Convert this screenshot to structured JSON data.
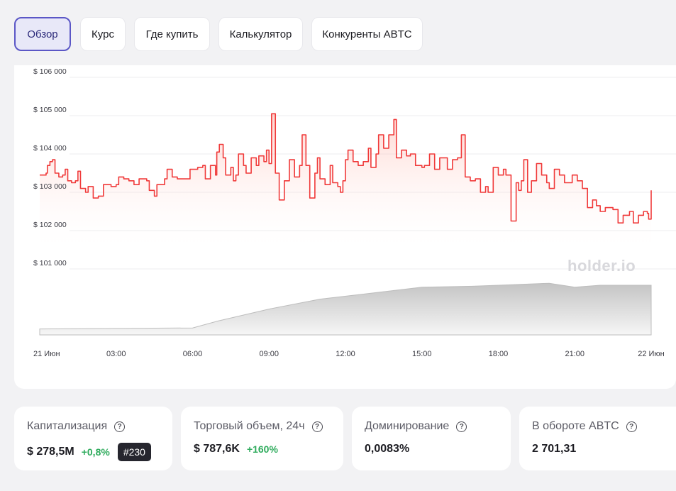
{
  "tabs": [
    {
      "label": "Обзор",
      "active": true
    },
    {
      "label": "Курс",
      "active": false
    },
    {
      "label": "Где купить",
      "active": false
    },
    {
      "label": "Калькулятор",
      "active": false
    },
    {
      "label": "Конкуренты ABTC",
      "active": false
    }
  ],
  "watermark": "holder.io",
  "chart_data": {
    "type": "line",
    "y_tick_labels": [
      "$ 106 000",
      "$ 105 000",
      "$ 104 000",
      "$ 103 000",
      "$ 102 000",
      "$ 101 000"
    ],
    "y_ticks": [
      106000,
      105000,
      104000,
      103000,
      102000,
      101000
    ],
    "ylim": [
      101000,
      106500
    ],
    "x_tick_labels": [
      "21 Июн",
      "03:00",
      "06:00",
      "09:00",
      "12:00",
      "15:00",
      "18:00",
      "21:00",
      "22 Июн"
    ],
    "x_ticks_hours": [
      0,
      3,
      6,
      9,
      12,
      15,
      18,
      21,
      24
    ],
    "xlim_hours": [
      0,
      24
    ],
    "line_color": "#f03a3a",
    "volume_color": "#cfcfcf",
    "grid": true,
    "series": [
      {
        "values": [
          [
            0.0,
            103450
          ],
          [
            0.25,
            103500
          ],
          [
            0.3,
            103700
          ],
          [
            0.4,
            103800
          ],
          [
            0.5,
            103850
          ],
          [
            0.6,
            103500
          ],
          [
            0.75,
            103400
          ],
          [
            0.9,
            103450
          ],
          [
            1.0,
            103600
          ],
          [
            1.1,
            103300
          ],
          [
            1.25,
            103250
          ],
          [
            1.4,
            103300
          ],
          [
            1.5,
            103550
          ],
          [
            1.6,
            103100
          ],
          [
            1.8,
            103000
          ],
          [
            1.9,
            103150
          ],
          [
            2.1,
            102850
          ],
          [
            2.3,
            102900
          ],
          [
            2.5,
            103200
          ],
          [
            2.8,
            103150
          ],
          [
            3.0,
            103200
          ],
          [
            3.1,
            103400
          ],
          [
            3.3,
            103350
          ],
          [
            3.5,
            103300
          ],
          [
            3.7,
            103200
          ],
          [
            3.9,
            103350
          ],
          [
            4.2,
            103300
          ],
          [
            4.3,
            103050
          ],
          [
            4.5,
            102900
          ],
          [
            4.6,
            103200
          ],
          [
            4.9,
            103350
          ],
          [
            5.0,
            103600
          ],
          [
            5.2,
            103400
          ],
          [
            5.4,
            103350
          ],
          [
            5.8,
            103350
          ],
          [
            5.9,
            103600
          ],
          [
            6.2,
            103650
          ],
          [
            6.4,
            103700
          ],
          [
            6.5,
            103350
          ],
          [
            6.7,
            103700
          ],
          [
            6.9,
            103450
          ],
          [
            6.95,
            104050
          ],
          [
            7.05,
            104250
          ],
          [
            7.2,
            103900
          ],
          [
            7.3,
            103450
          ],
          [
            7.5,
            103650
          ],
          [
            7.6,
            103300
          ],
          [
            7.7,
            103450
          ],
          [
            7.8,
            104000
          ],
          [
            8.0,
            103700
          ],
          [
            8.1,
            103500
          ],
          [
            8.3,
            103900
          ],
          [
            8.5,
            103700
          ],
          [
            8.6,
            103950
          ],
          [
            8.8,
            103800
          ],
          [
            8.9,
            104100
          ],
          [
            9.0,
            103750
          ],
          [
            9.1,
            105050
          ],
          [
            9.25,
            103500
          ],
          [
            9.4,
            102800
          ],
          [
            9.6,
            103300
          ],
          [
            9.8,
            103850
          ],
          [
            10.0,
            103400
          ],
          [
            10.2,
            103700
          ],
          [
            10.3,
            104500
          ],
          [
            10.45,
            103700
          ],
          [
            10.6,
            102850
          ],
          [
            10.8,
            103500
          ],
          [
            10.9,
            103900
          ],
          [
            11.0,
            103350
          ],
          [
            11.2,
            103200
          ],
          [
            11.4,
            103700
          ],
          [
            11.5,
            103250
          ],
          [
            11.7,
            103150
          ],
          [
            11.8,
            103000
          ],
          [
            11.9,
            103300
          ],
          [
            12.0,
            103850
          ],
          [
            12.1,
            104100
          ],
          [
            12.3,
            103800
          ],
          [
            12.5,
            103700
          ],
          [
            12.7,
            103800
          ],
          [
            12.9,
            104150
          ],
          [
            13.0,
            103650
          ],
          [
            13.2,
            104000
          ],
          [
            13.3,
            104500
          ],
          [
            13.5,
            104150
          ],
          [
            13.7,
            104500
          ],
          [
            13.9,
            104900
          ],
          [
            14.0,
            103900
          ],
          [
            14.2,
            104100
          ],
          [
            14.4,
            103950
          ],
          [
            14.55,
            104000
          ],
          [
            14.75,
            103700
          ],
          [
            15.0,
            103650
          ],
          [
            15.1,
            103700
          ],
          [
            15.3,
            104000
          ],
          [
            15.5,
            103600
          ],
          [
            15.7,
            103900
          ],
          [
            16.0,
            103600
          ],
          [
            16.2,
            103850
          ],
          [
            16.4,
            103900
          ],
          [
            16.55,
            104500
          ],
          [
            16.7,
            103400
          ],
          [
            16.9,
            103300
          ],
          [
            17.1,
            103350
          ],
          [
            17.3,
            103000
          ],
          [
            17.5,
            103150
          ],
          [
            17.6,
            103000
          ],
          [
            17.8,
            103650
          ],
          [
            18.0,
            103450
          ],
          [
            18.2,
            103600
          ],
          [
            18.3,
            103450
          ],
          [
            18.5,
            102250
          ],
          [
            18.7,
            103250
          ],
          [
            18.8,
            103050
          ],
          [
            18.9,
            103300
          ],
          [
            19.0,
            103850
          ],
          [
            19.15,
            103000
          ],
          [
            19.3,
            103300
          ],
          [
            19.5,
            103750
          ],
          [
            19.7,
            103450
          ],
          [
            19.9,
            103250
          ],
          [
            20.0,
            103100
          ],
          [
            20.2,
            103600
          ],
          [
            20.4,
            103450
          ],
          [
            20.6,
            103250
          ],
          [
            20.9,
            103450
          ],
          [
            21.1,
            103300
          ],
          [
            21.3,
            103100
          ],
          [
            21.5,
            102600
          ],
          [
            21.7,
            102800
          ],
          [
            21.85,
            102650
          ],
          [
            22.0,
            102500
          ],
          [
            22.2,
            102600
          ],
          [
            22.5,
            102550
          ],
          [
            22.7,
            102200
          ],
          [
            22.9,
            102400
          ],
          [
            23.15,
            102500
          ],
          [
            23.3,
            102200
          ],
          [
            23.5,
            102400
          ],
          [
            23.7,
            102500
          ],
          [
            23.85,
            102450
          ],
          [
            23.9,
            102300
          ],
          [
            24.0,
            103050
          ]
        ]
      }
    ],
    "volume_profile_hours_relative": [
      [
        0,
        0.06
      ],
      [
        6,
        0.07
      ],
      [
        7,
        0.14
      ],
      [
        9,
        0.26
      ],
      [
        11,
        0.36
      ],
      [
        13,
        0.42
      ],
      [
        15,
        0.48
      ],
      [
        17,
        0.49
      ],
      [
        18,
        0.5
      ],
      [
        20,
        0.52
      ],
      [
        21,
        0.48
      ],
      [
        22,
        0.5
      ],
      [
        23,
        0.5
      ],
      [
        24,
        0.5
      ]
    ]
  },
  "stats": [
    {
      "label": "Капитализация",
      "value": "$ 278,5M",
      "change": "+0,8%",
      "rank": "#230"
    },
    {
      "label": "Торговый объем, 24ч",
      "value": "$ 787,6K",
      "change": "+160%"
    },
    {
      "label": "Доминирование",
      "value": "0,0083%"
    },
    {
      "label": "В обороте ABTC",
      "value": "2 701,31"
    }
  ],
  "icons": {
    "help": "question-circle-icon"
  }
}
